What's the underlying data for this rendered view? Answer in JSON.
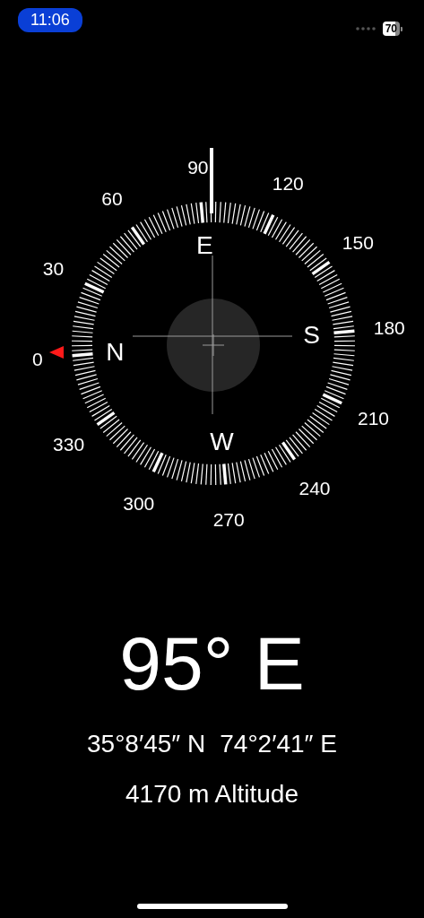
{
  "status_bar": {
    "time": "11:06",
    "battery": "70"
  },
  "compass": {
    "degree_labels": [
      "0",
      "30",
      "60",
      "90",
      "120",
      "150",
      "180",
      "210",
      "240",
      "270",
      "300",
      "330"
    ],
    "cardinals": [
      "N",
      "E",
      "S",
      "W"
    ]
  },
  "heading": "95° E",
  "coordinates": {
    "latitude": "35°8′45″ N",
    "longitude": "74°2′41″ E"
  },
  "altitude": "4170 m Altitude"
}
